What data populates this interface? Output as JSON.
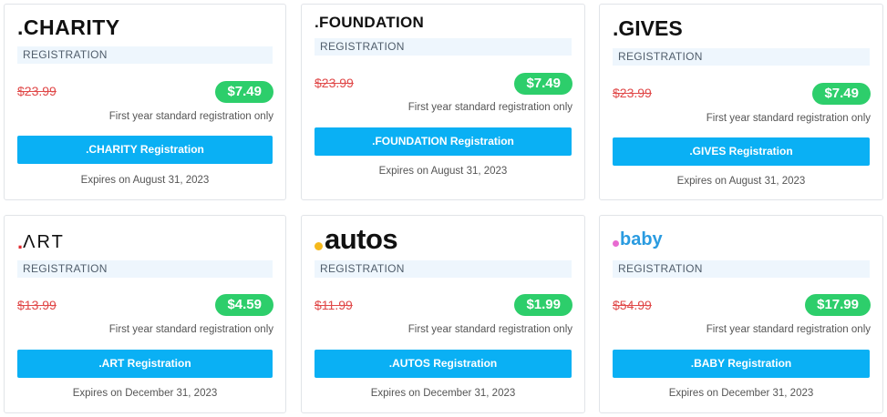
{
  "cards": [
    {
      "logo": ".CHARITY",
      "strip": "REGISTRATION",
      "old_price": "$23.99",
      "price": "$7.49",
      "note": "First year standard registration only",
      "button": ".CHARITY Registration",
      "expires": "Expires on August 31, 2023"
    },
    {
      "logo": ".FOUNDATION",
      "strip": "REGISTRATION",
      "old_price": "$23.99",
      "price": "$7.49",
      "note": "First year standard registration only",
      "button": ".FOUNDATION Registration",
      "expires": "Expires on August 31, 2023"
    },
    {
      "logo": ".GIVES",
      "strip": "REGISTRATION",
      "old_price": "$23.99",
      "price": "$7.49",
      "note": "First year standard registration only",
      "button": ".GIVES Registration",
      "expires": "Expires on August 31, 2023"
    },
    {
      "logo_dot": ".",
      "logo": "ΛRT",
      "strip": "REGISTRATION",
      "old_price": "$13.99",
      "price": "$4.59",
      "note": "First year standard registration only",
      "button": ".ART Registration",
      "expires": "Expires on December 31, 2023"
    },
    {
      "logo": "autos",
      "strip": "REGISTRATION",
      "old_price": "$11.99",
      "price": "$1.99",
      "note": "First year standard registration only",
      "button": ".AUTOS Registration",
      "expires": "Expires on December 31, 2023"
    },
    {
      "logo": "baby",
      "strip": "REGISTRATION",
      "old_price": "$54.99",
      "price": "$17.99",
      "note": "First year standard registration only",
      "button": ".BABY Registration",
      "expires": "Expires on December 31, 2023"
    }
  ],
  "colors": {
    "price_badge": "#2dce6b",
    "button": "#0ab0f4",
    "old_price": "#e04848",
    "strip_bg": "#eef6fd"
  }
}
